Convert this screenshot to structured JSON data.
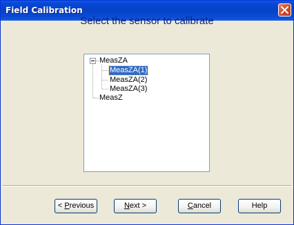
{
  "window": {
    "title": "Field Calibration"
  },
  "heading": "Select the sensor to calibrate",
  "tree": {
    "root": {
      "label": "MeasZA",
      "expanded": true,
      "children": [
        {
          "label": "MeasZA(1)",
          "selected": true
        },
        {
          "label": "MeasZA(2)",
          "selected": false
        },
        {
          "label": "MeasZA(3)",
          "selected": false
        }
      ]
    },
    "second": {
      "label": "MeasZ"
    }
  },
  "buttons": {
    "previous": {
      "prefix": "< ",
      "accel": "P",
      "rest": "revious"
    },
    "next": {
      "accel": "N",
      "rest": "ext >"
    },
    "cancel": {
      "accel": "C",
      "rest": "ancel"
    },
    "help": {
      "label": "Help"
    }
  },
  "colors": {
    "title_bar": "#0848d4",
    "heading_text": "#0a1f7a",
    "selection": "#316ac5",
    "dialog_bg": "#ece9d8"
  }
}
